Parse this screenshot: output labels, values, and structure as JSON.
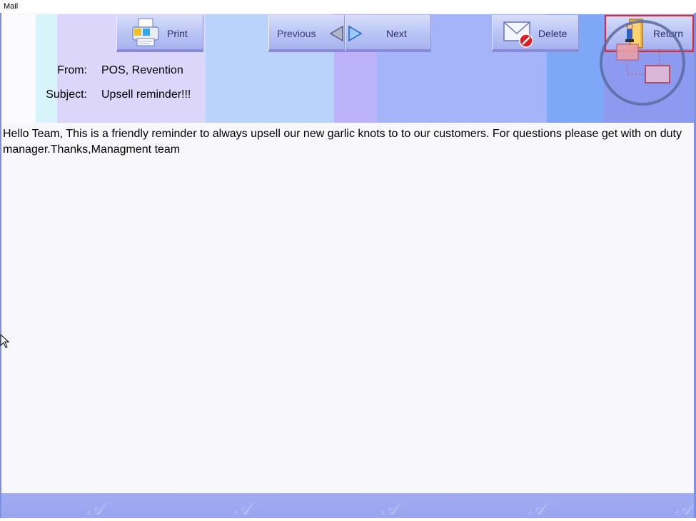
{
  "window": {
    "title": "Mail"
  },
  "toolbar": {
    "print_label": "Print",
    "previous_label": "Previous",
    "next_label": "Next",
    "delete_label": "Delete",
    "return_label": "Return"
  },
  "message": {
    "from_label": "From:",
    "from_value": "POS, Revention",
    "subject_label": "Subject:",
    "subject_value": "Upsell reminder!!!",
    "body": "Hello Team, This is a friendly reminder to always upsell our new garlic knots to to our customers. For questions please get with on duty manager.Thanks,Managment team"
  },
  "icons": {
    "print": "printer-icon",
    "previous": "arrow-left-icon",
    "next": "arrow-right-icon",
    "delete": "mail-delete-icon",
    "return": "exit-door-icon",
    "overlay": "network-overlay-icon"
  },
  "colors": {
    "header_bg": "#b8c8ff",
    "footer_bg": "#9aa5f0",
    "return_highlight": "#e1262c",
    "body_bg": "#f8f8fc"
  }
}
